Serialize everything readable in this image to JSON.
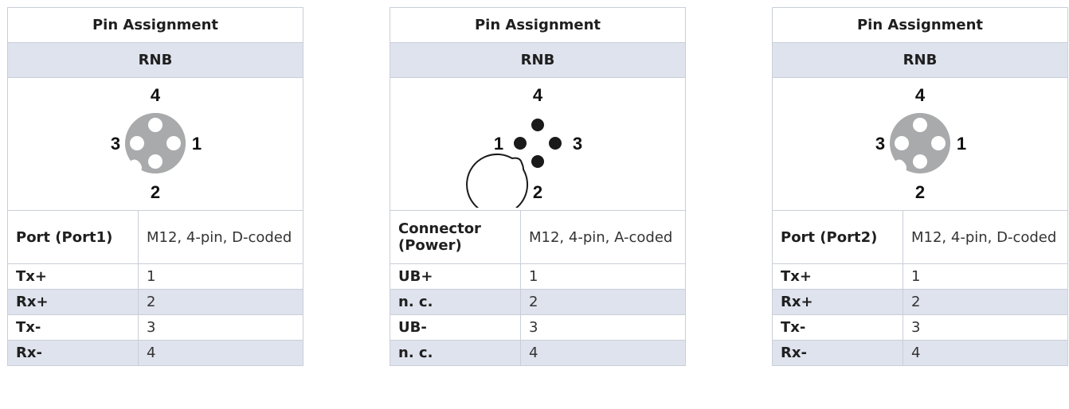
{
  "tables": [
    {
      "title": "Pin Assignment",
      "subtitle": "RNB",
      "connector_type": "female-d-coded",
      "pin_labels": {
        "top": "4",
        "left": "3",
        "right": "1",
        "bottom": "2"
      },
      "port_label": "Port (Port1)",
      "port_value": "M12, 4-pin, D-coded",
      "rows": [
        {
          "signal": "Tx+",
          "pin": "1"
        },
        {
          "signal": "Rx+",
          "pin": "2"
        },
        {
          "signal": "Tx-",
          "pin": "3"
        },
        {
          "signal": "Rx-",
          "pin": "4"
        }
      ]
    },
    {
      "title": "Pin Assignment",
      "subtitle": "RNB",
      "connector_type": "male-a-coded",
      "pin_labels": {
        "top": "4",
        "left": "1",
        "right": "3",
        "bottom": "2"
      },
      "port_label": "Connector (Power)",
      "port_value": "M12, 4-pin, A-coded",
      "rows": [
        {
          "signal": "UB+",
          "pin": "1"
        },
        {
          "signal": "n. c.",
          "pin": "2"
        },
        {
          "signal": "UB-",
          "pin": "3"
        },
        {
          "signal": "n. c.",
          "pin": "4"
        }
      ]
    },
    {
      "title": "Pin Assignment",
      "subtitle": "RNB",
      "connector_type": "female-d-coded",
      "pin_labels": {
        "top": "4",
        "left": "3",
        "right": "1",
        "bottom": "2"
      },
      "port_label": "Port (Port2)",
      "port_value": "M12, 4-pin, D-coded",
      "rows": [
        {
          "signal": "Tx+",
          "pin": "1"
        },
        {
          "signal": "Rx+",
          "pin": "2"
        },
        {
          "signal": "Tx-",
          "pin": "3"
        },
        {
          "signal": "Rx-",
          "pin": "4"
        }
      ]
    }
  ]
}
